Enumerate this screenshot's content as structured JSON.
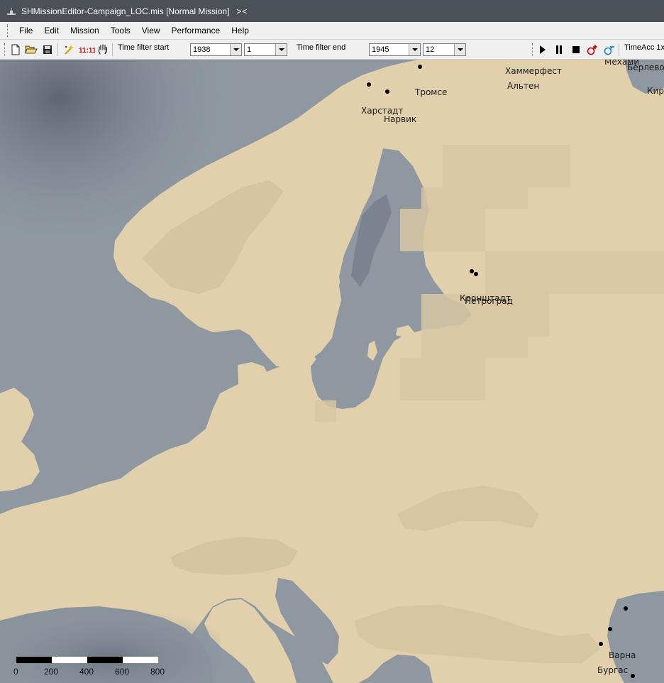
{
  "window": {
    "title": "SHMissionEditor-Campaign_LOC.mis [Normal Mission]",
    "title_suffix": "><"
  },
  "menu": [
    "File",
    "Edit",
    "Mission",
    "Tools",
    "View",
    "Performance",
    "Help"
  ],
  "toolbar": {
    "new_icon": "new-file-icon",
    "open_icon": "open-folder-icon",
    "save_icon": "save-disk-icon",
    "wand_icon": "magic-wand-icon",
    "clock_text": "11:11",
    "hand_icon": "hand-pan-icon",
    "time_filter_start_label": "Time filter start",
    "start_year": "1938",
    "start_month": "1",
    "time_filter_end_label": "Time filter end",
    "end_year": "1945",
    "end_month": "12",
    "play_icon": "play-icon",
    "pause_icon": "pause-icon",
    "stop_icon": "stop-icon",
    "add_unit_icon": "add-unit-icon",
    "remove_unit_icon": "remove-unit-icon",
    "time_acc_label": "TimeAcc 1x"
  },
  "map": {
    "colors": {
      "sea": "#8f98a1",
      "deep_sea": "#6c7480",
      "land": "#e2d0ad",
      "highland": "#cdb995",
      "grid_patch": "#d8c6a4"
    },
    "cities": [
      {
        "name": "Хаммерфест"
      },
      {
        "name": "Альтен"
      },
      {
        "name": "Мехами"
      },
      {
        "name": "Берлевог"
      },
      {
        "name": "Кирк"
      },
      {
        "name": "Тромсе"
      },
      {
        "name": "Харстадт"
      },
      {
        "name": "Нарвик"
      },
      {
        "name": "Кронштадт"
      },
      {
        "name": "Петроград"
      },
      {
        "name": "Варна"
      },
      {
        "name": "Бургас"
      }
    ],
    "scale_bar": {
      "ticks": [
        "0",
        "200",
        "400",
        "600",
        "800"
      ]
    }
  }
}
